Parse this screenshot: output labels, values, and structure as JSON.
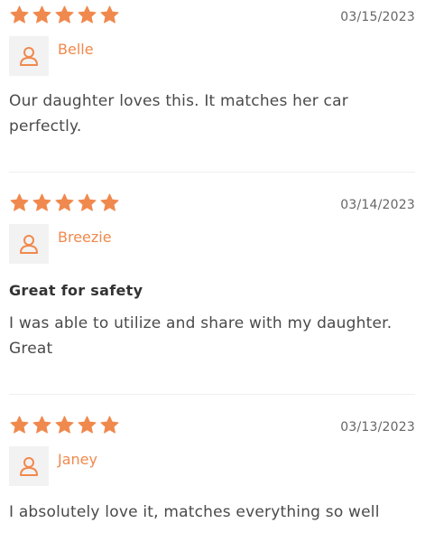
{
  "reviews": [
    {
      "rating": 5,
      "date": "03/15/2023",
      "author": "Belle",
      "title": "",
      "body": "Our daughter loves this. It matches her car perfectly."
    },
    {
      "rating": 5,
      "date": "03/14/2023",
      "author": "Breezie",
      "title": "Great for safety",
      "body": "I was able to utilize and share with my daughter. Great"
    },
    {
      "rating": 5,
      "date": "03/13/2023",
      "author": "Janey",
      "title": "",
      "body": "I absolutely love it, matches everything so well"
    }
  ],
  "colors": {
    "star": "#f0894d",
    "author": "#f0894d",
    "avatar_bg": "#f2f2f2"
  },
  "icons": {
    "star": "star-icon",
    "avatar": "user-icon"
  }
}
